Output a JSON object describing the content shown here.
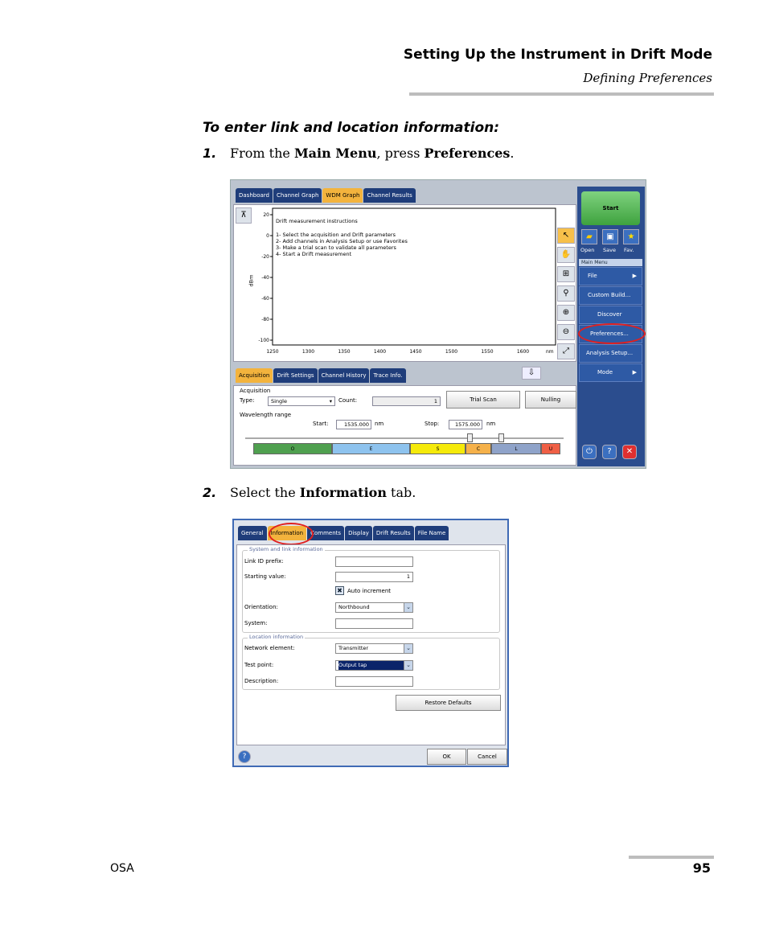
{
  "header": {
    "title": "Setting Up the Instrument in Drift Mode",
    "subtitle": "Defining Preferences"
  },
  "procedure_title": "To enter link and location information:",
  "steps": [
    {
      "num": "1.",
      "t1": "From the ",
      "b1": "Main Menu",
      "t2": ", press ",
      "b2": "Preferences",
      "t3": "."
    },
    {
      "num": "2.",
      "t1": "Select the ",
      "b1": "Information",
      "t2": " tab."
    }
  ],
  "shot1": {
    "top_tabs": [
      "Dashboard",
      "Channel Graph",
      "WDM Graph",
      "Channel Results"
    ],
    "instructions_title": "Drift measurement instructions",
    "instructions": [
      "1- Select the acquisition and Drift parameters",
      "2- Add channels in Analysis Setup or use Favorites",
      "3- Make a trial scan to validate all parameters",
      "4- Start a Drift measurement"
    ],
    "y_ticks": [
      "20",
      "0",
      "-20",
      "-40",
      "-60",
      "-80",
      "-100"
    ],
    "x_ticks": [
      "1250",
      "1300",
      "1350",
      "1400",
      "1450",
      "1500",
      "1550",
      "1600"
    ],
    "x_unit": "nm",
    "y_label": "dBm",
    "bottom_tabs": [
      "Acquisition",
      "Drift Settings",
      "Channel History",
      "Trace Info."
    ],
    "acquisition_label": "Acquisition",
    "type_label": "Type:",
    "type_value": "Single",
    "count_label": "Count:",
    "count_value": "1",
    "trial_scan": "Trial Scan",
    "nulling": "Nulling",
    "wl_label": "Wavelength range",
    "start_label": "Start:",
    "start_value": "1535.000",
    "stop_label": "Stop:",
    "stop_value": "1575.000",
    "nm": "nm",
    "bands": [
      {
        "name": "O",
        "color": "#4fa04f"
      },
      {
        "name": "E",
        "color": "#8ec3ee"
      },
      {
        "name": "S",
        "color": "#f5ea0a"
      },
      {
        "name": "C",
        "color": "#f5b14a"
      },
      {
        "name": "L",
        "color": "#8fa3c9"
      },
      {
        "name": "U",
        "color": "#ef5f45"
      }
    ],
    "start": "Start",
    "open": "Open",
    "save": "Save",
    "fav": "Fav.",
    "main_menu": "Main Menu",
    "menu": [
      "File",
      "Custom Build...",
      "Discover",
      "Preferences...",
      "Analysis Setup...",
      "Mode"
    ]
  },
  "shot2": {
    "tabs": [
      "General",
      "Information",
      "Comments",
      "Display",
      "Drift Results",
      "File Name"
    ],
    "grp1": "System and link information",
    "link_label": "Link ID prefix:",
    "start_label": "Starting value:",
    "start_value": "1",
    "auto_inc": "Auto increment",
    "orient_label": "Orientation:",
    "orient_value": "Northbound",
    "system_label": "System:",
    "grp2": "Location information",
    "ne_label": "Network element:",
    "ne_value": "Transmitter",
    "tp_label": "Test point:",
    "tp_value": "Output tap",
    "desc_label": "Description:",
    "restore": "Restore Defaults",
    "ok": "OK",
    "cancel": "Cancel"
  },
  "footer": {
    "left": "OSA",
    "page": "95"
  }
}
